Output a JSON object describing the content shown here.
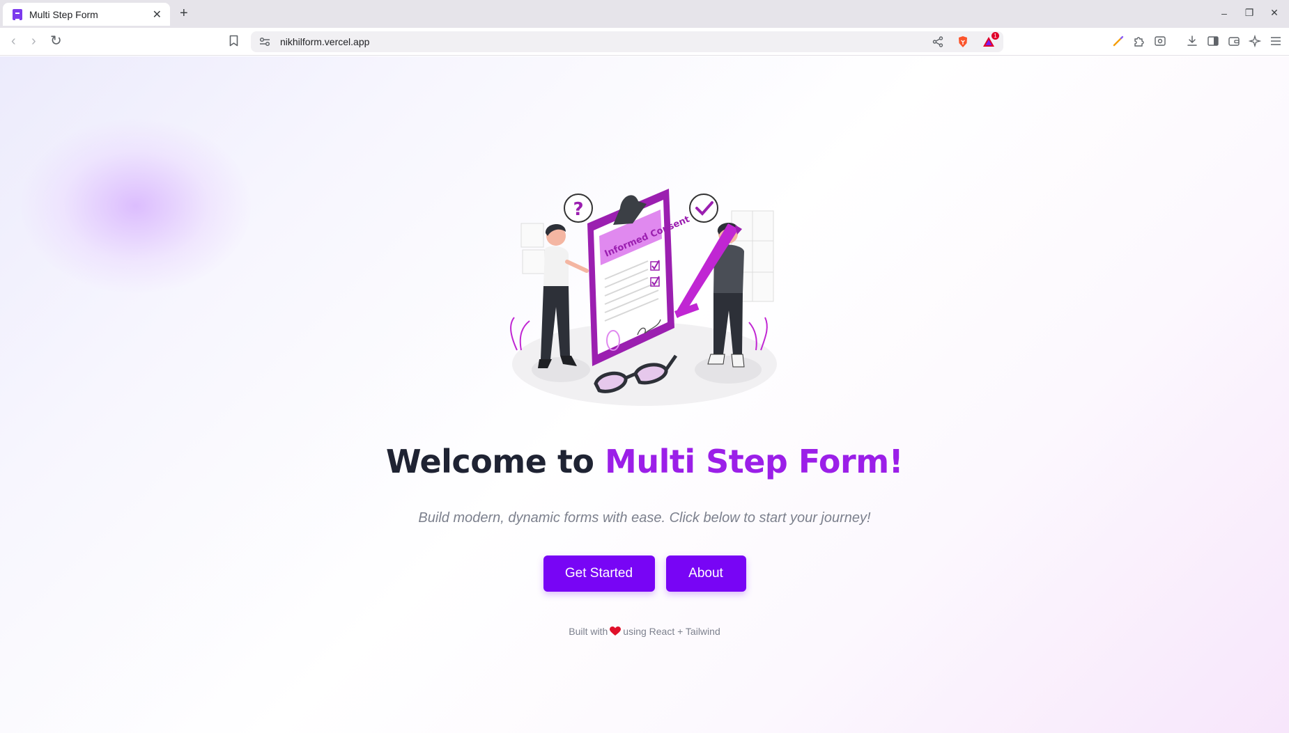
{
  "browser": {
    "tab": {
      "title": "Multi Step Form",
      "close_glyph": "✕"
    },
    "new_tab_glyph": "+",
    "window_controls": {
      "minimize": "–",
      "maximize": "❐",
      "close": "✕"
    },
    "nav": {
      "back": "‹",
      "forward": "›",
      "reload": "↻"
    },
    "url": "nikhilform.vercel.app",
    "rewards_badge": "1",
    "icons": [
      "bookmark-icon",
      "site-settings-icon",
      "share-icon",
      "brave-shields-icon",
      "brave-rewards-icon",
      "leo-pen-icon",
      "extensions-icon",
      "screenshot-icon",
      "download-icon",
      "sidebar-icon",
      "wallet-icon",
      "leo-ai-icon",
      "menu-icon"
    ]
  },
  "hero": {
    "title_prefix": "Welcome to ",
    "title_accent": "Multi Step Form!",
    "subtitle": "Build modern, dynamic forms with ease. Click below to start your journey!",
    "illustration_label": "Informed Consent"
  },
  "actions": {
    "get_started": "Get Started",
    "about": "About"
  },
  "footer": {
    "prefix": "Built with",
    "suffix": "using React + Tailwind"
  },
  "colors": {
    "accent": "#9b1fe8",
    "button": "#7805f5",
    "title": "#1f2333",
    "muted": "#7c808d"
  }
}
